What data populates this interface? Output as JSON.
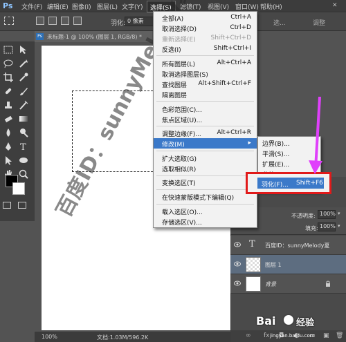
{
  "menubar": {
    "logo": "Ps",
    "items": [
      "文件(F)",
      "编辑(E)",
      "图像(I)",
      "图层(L)",
      "文字(Y)",
      "选择(S)",
      "滤镜(T)",
      "视图(V)",
      "窗口(W)",
      "帮助(H)"
    ]
  },
  "options": {
    "feather_label": "羽化:",
    "feather_value": "0 像素",
    "right_label": "选...",
    "right_label2": "调整"
  },
  "document": {
    "tab_title": "未标题-1 @ 100% (图层 1, RGB/8) *",
    "zoom": "100%",
    "doc_info": "文档:1.03M/596.2K"
  },
  "select_menu": {
    "items": [
      {
        "label": "全部(A)",
        "shortcut": "Ctrl+A"
      },
      {
        "label": "取消选择(D)",
        "shortcut": "Ctrl+D"
      },
      {
        "label": "重新选择(E)",
        "shortcut": "Shift+Ctrl+D",
        "disabled": true
      },
      {
        "label": "反选(I)",
        "shortcut": "Shift+Ctrl+I"
      },
      {
        "label": "所有图层(L)",
        "shortcut": "Alt+Ctrl+A"
      },
      {
        "label": "取消选择图层(S)",
        "shortcut": ""
      },
      {
        "label": "查找图层",
        "shortcut": "Alt+Shift+Ctrl+F"
      },
      {
        "label": "隔离图层",
        "shortcut": ""
      },
      {
        "label": "色彩范围(C)...",
        "shortcut": ""
      },
      {
        "label": "焦点区域(U)...",
        "shortcut": ""
      },
      {
        "label": "调整边缘(F)...",
        "shortcut": "Alt+Ctrl+R"
      },
      {
        "label": "修改(M)",
        "shortcut": "",
        "submenu": true
      },
      {
        "label": "扩大选取(G)",
        "shortcut": ""
      },
      {
        "label": "选取相似(R)",
        "shortcut": ""
      },
      {
        "label": "变换选区(T)",
        "shortcut": ""
      },
      {
        "label": "在快速蒙版模式下编辑(Q)",
        "shortcut": ""
      },
      {
        "label": "载入选区(O)...",
        "shortcut": ""
      },
      {
        "label": "存储选区(V)...",
        "shortcut": ""
      }
    ]
  },
  "modify_submenu": {
    "items": [
      {
        "label": "边界(B)...",
        "shortcut": ""
      },
      {
        "label": "平滑(S)...",
        "shortcut": ""
      },
      {
        "label": "扩展(E)...",
        "shortcut": ""
      },
      {
        "label": "收缩(C)...",
        "shortcut": ""
      },
      {
        "label": "羽化(F)...",
        "shortcut": "Shift+F6"
      }
    ]
  },
  "layers_panel": {
    "opacity_label": "不透明度:",
    "opacity_value": "100%",
    "fill_label": "填充:",
    "fill_value": "100%",
    "layers": [
      {
        "name": "百度ID：sunnyMelody夏",
        "type": "text"
      },
      {
        "name": "图层 1",
        "type": "pixel",
        "selected": true
      },
      {
        "name": "背景",
        "type": "background",
        "locked": true
      }
    ]
  },
  "watermark": {
    "text_main": "百度ID：sunnyMelody夏",
    "brand": "Bai",
    "brand2": "经验",
    "url": "jingyan.baidu.com"
  },
  "colors": {
    "highlight": "#e11a1a",
    "menu_hover": "#3b79c9",
    "arrow": "#e040fb"
  }
}
